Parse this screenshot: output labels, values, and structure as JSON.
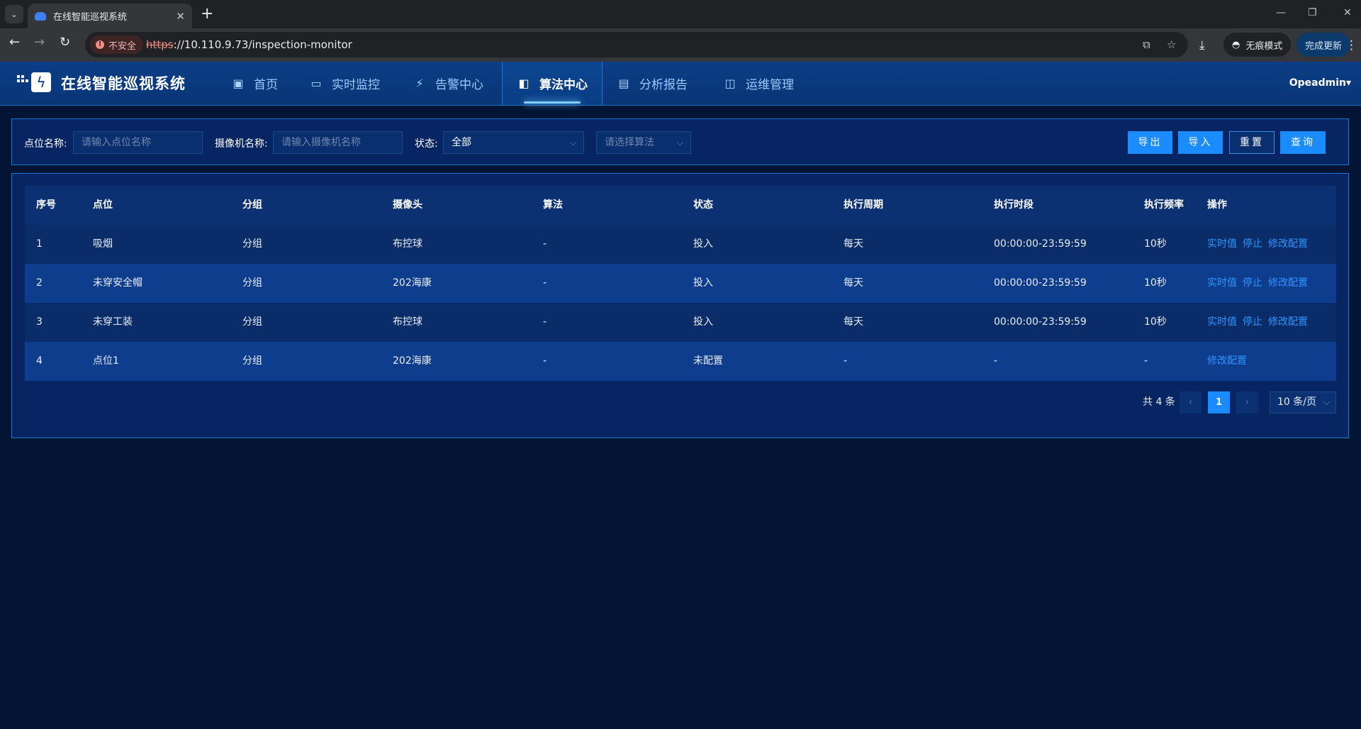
{
  "browser": {
    "tab_title": "在线智能巡视系统",
    "security_label": "不安全",
    "url_protocol": "https",
    "url_rest": "://10.110.9.73/inspection-monitor",
    "incognito_label": "无痕模式",
    "update_label": "完成更新"
  },
  "app": {
    "brand": "在线智能巡视系统",
    "user": "Opeadmin",
    "nav": [
      {
        "label": "首页",
        "icon": "home-icon"
      },
      {
        "label": "实时监控",
        "icon": "monitor-icon"
      },
      {
        "label": "告警中心",
        "icon": "alert-icon"
      },
      {
        "label": "算法中心",
        "icon": "algorithm-icon",
        "active": true
      },
      {
        "label": "分析报告",
        "icon": "report-icon"
      },
      {
        "label": "运维管理",
        "icon": "maintenance-icon"
      }
    ]
  },
  "filter": {
    "point_label": "点位名称:",
    "point_placeholder": "请输入点位名称",
    "camera_label": "摄像机名称:",
    "camera_placeholder": "请输入摄像机名称",
    "status_label": "状态:",
    "status_value": "全部",
    "algorithm_placeholder": "请选择算法",
    "export": "导出",
    "import": "导入",
    "reset": "重置",
    "query": "查询"
  },
  "table": {
    "columns": [
      "序号",
      "点位",
      "分组",
      "摄像头",
      "算法",
      "状态",
      "执行周期",
      "执行时段",
      "执行频率",
      "操作"
    ],
    "rows": [
      {
        "no": "1",
        "point": "吸烟",
        "group": "分组",
        "camera": "布控球",
        "algo": "-",
        "status": "投入",
        "cycle": "每天",
        "period": "00:00:00-23:59:59",
        "freq": "10秒",
        "ops": [
          "实时值",
          "停止",
          "修改配置"
        ]
      },
      {
        "no": "2",
        "point": "未穿安全帽",
        "group": "分组",
        "camera": "202海康",
        "algo": "-",
        "status": "投入",
        "cycle": "每天",
        "period": "00:00:00-23:59:59",
        "freq": "10秒",
        "ops": [
          "实时值",
          "停止",
          "修改配置"
        ]
      },
      {
        "no": "3",
        "point": "未穿工装",
        "group": "分组",
        "camera": "布控球",
        "algo": "-",
        "status": "投入",
        "cycle": "每天",
        "period": "00:00:00-23:59:59",
        "freq": "10秒",
        "ops": [
          "实时值",
          "停止",
          "修改配置"
        ]
      },
      {
        "no": "4",
        "point": "点位1",
        "group": "分组",
        "camera": "202海康",
        "algo": "-",
        "status": "未配置",
        "cycle": "-",
        "period": "-",
        "freq": "-",
        "ops": [
          "修改配置"
        ]
      }
    ]
  },
  "pagination": {
    "total": "共 4 条",
    "current": "1",
    "page_size": "10 条/页"
  }
}
